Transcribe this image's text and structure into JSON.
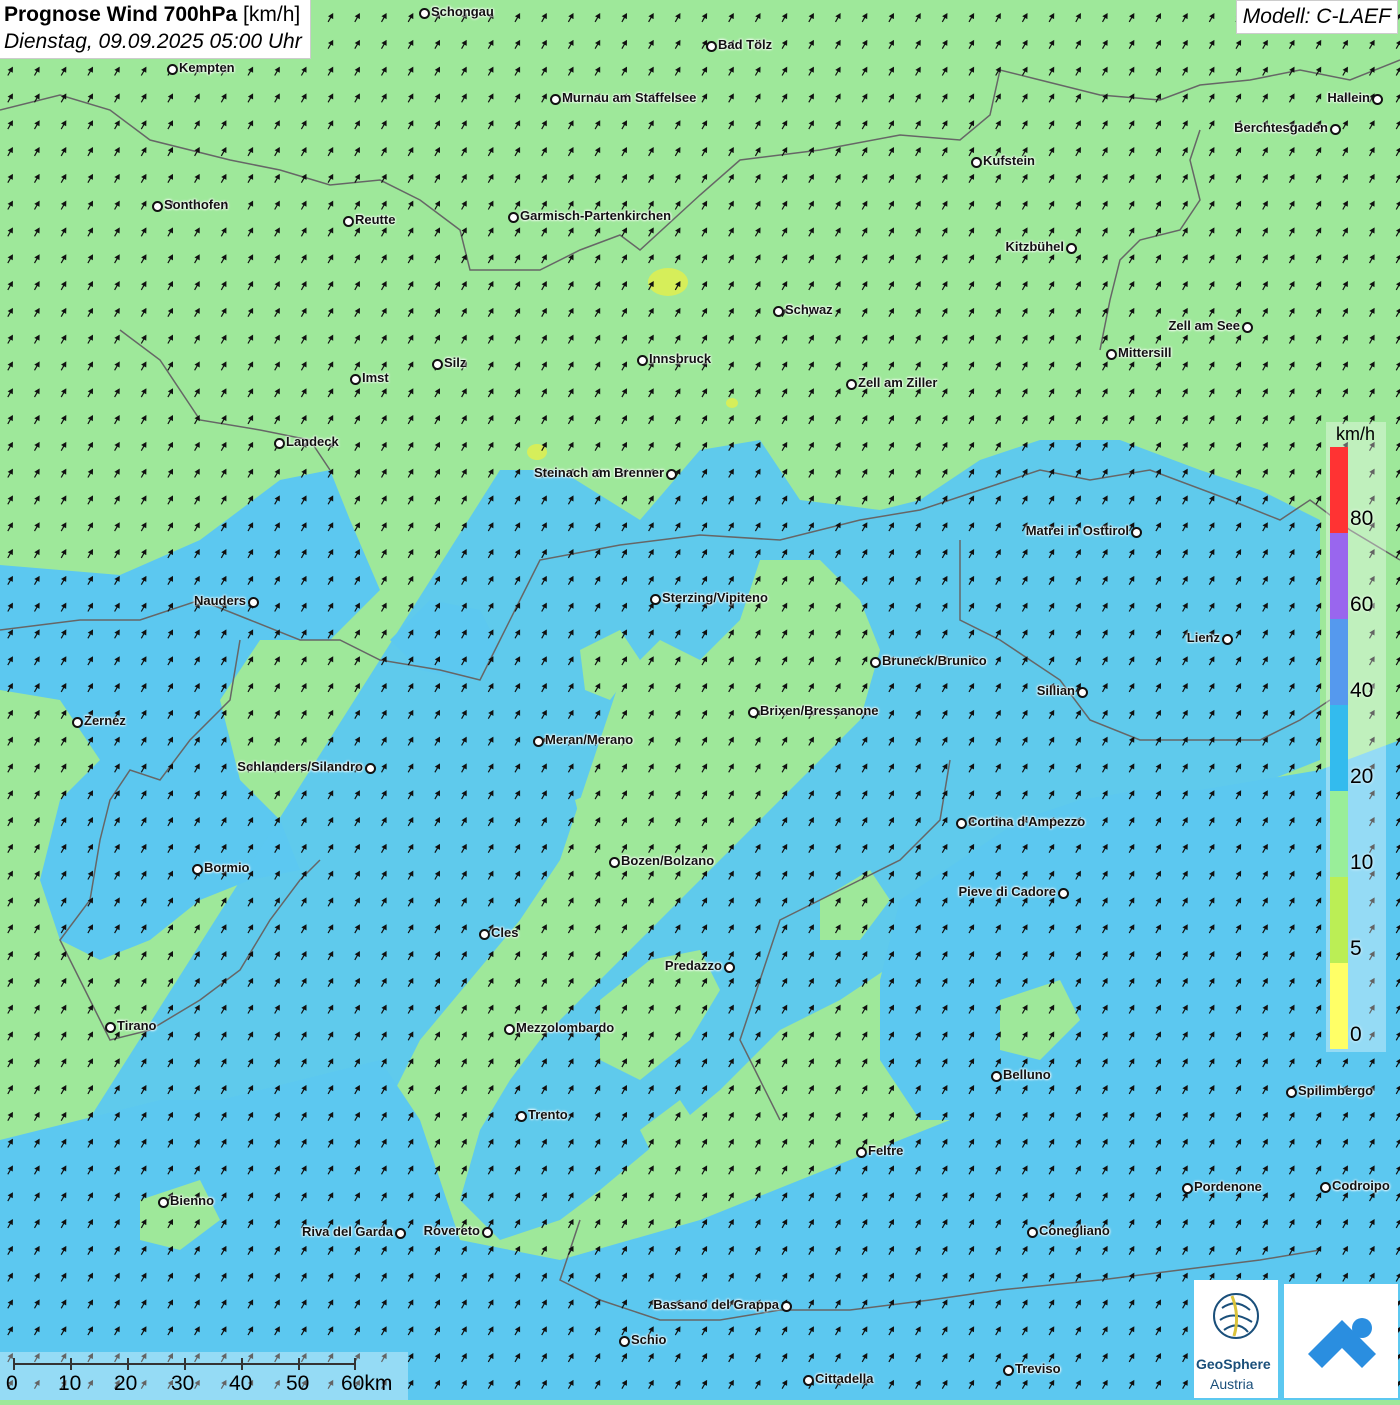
{
  "title": {
    "main": "Prognose Wind 700hPa",
    "unit": "[km/h]",
    "date": "Dienstag, 09.09.2025 05:00 Uhr"
  },
  "model": "Modell: C-LAEF",
  "legend": {
    "unit": "km/h",
    "ticks": [
      "80",
      "60",
      "40",
      "20",
      "10",
      "5",
      "0"
    ],
    "colors": [
      "#ff3333",
      "#9966ee",
      "#5599ee",
      "#33bbee",
      "#99ee99",
      "#bbee55",
      "#ffff66"
    ]
  },
  "scale": {
    "labels": [
      "0",
      "10",
      "20",
      "30",
      "40",
      "50",
      "60km"
    ]
  },
  "logo": {
    "name1": "GeoSphere",
    "name2": "Austria"
  },
  "cities": [
    {
      "name": "Schongau"
    },
    {
      "name": "Bad Tölz"
    },
    {
      "name": "Kempten"
    },
    {
      "name": "Murnau am Staffelsee"
    },
    {
      "name": "Hallein"
    },
    {
      "name": "Berchtesgaden"
    },
    {
      "name": "Kufstein"
    },
    {
      "name": "Sonthofen"
    },
    {
      "name": "Reutte"
    },
    {
      "name": "Garmisch-Partenkirchen"
    },
    {
      "name": "Kitzbühel"
    },
    {
      "name": "Schwaz"
    },
    {
      "name": "Zell am See"
    },
    {
      "name": "Mittersill"
    },
    {
      "name": "Imst"
    },
    {
      "name": "Silz"
    },
    {
      "name": "Innsbruck"
    },
    {
      "name": "Zell am Ziller"
    },
    {
      "name": "Landeck"
    },
    {
      "name": "Steinach am Brenner"
    },
    {
      "name": "Matrei in Osttirol"
    },
    {
      "name": "Nauders"
    },
    {
      "name": "Sterzing/Vipiteno"
    },
    {
      "name": "Lienz"
    },
    {
      "name": "Bruneck/Brunico"
    },
    {
      "name": "Sillian"
    },
    {
      "name": "Zernez"
    },
    {
      "name": "Brixen/Bressanone"
    },
    {
      "name": "Meran/Merano"
    },
    {
      "name": "Schlanders/Silandro"
    },
    {
      "name": "Cortina d'Ampezzo"
    },
    {
      "name": "Bozen/Bolzano"
    },
    {
      "name": "Bormio"
    },
    {
      "name": "Pieve di Cadore"
    },
    {
      "name": "Cles"
    },
    {
      "name": "Predazzo"
    },
    {
      "name": "Tirano"
    },
    {
      "name": "Mezzolombardo"
    },
    {
      "name": "Belluno"
    },
    {
      "name": "Spilimbergo"
    },
    {
      "name": "Trento"
    },
    {
      "name": "Feltre"
    },
    {
      "name": "Pordenone"
    },
    {
      "name": "Codroipo"
    },
    {
      "name": "Bienno"
    },
    {
      "name": "Riva del Garda"
    },
    {
      "name": "Rovereto"
    },
    {
      "name": "Conegliano"
    },
    {
      "name": "Bassano del Grappa"
    },
    {
      "name": "Schio"
    },
    {
      "name": "Treviso"
    },
    {
      "name": "Cittadella"
    }
  ]
}
